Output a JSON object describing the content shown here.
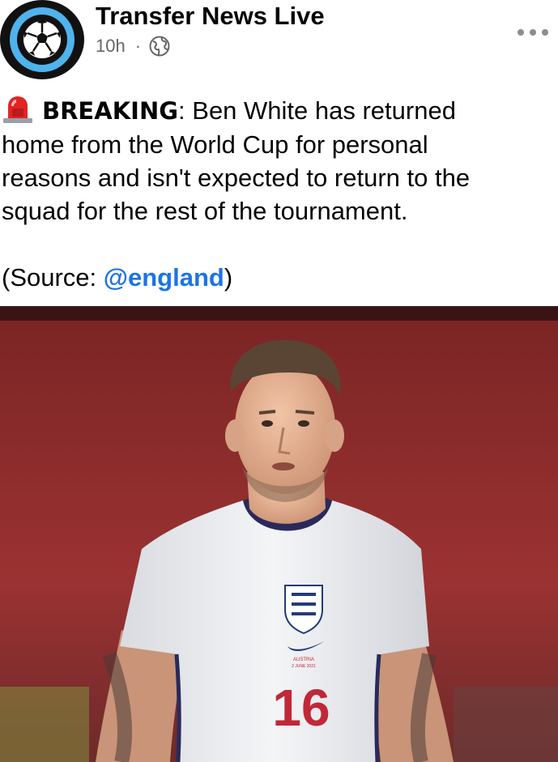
{
  "post": {
    "page_name": "Transfer News Live",
    "time": "10h",
    "separator": "·",
    "breaking_label": "BREAKING",
    "breaking_colon": ":",
    "body_line_1": " Ben White has returned",
    "body_line_2": "home from the World Cup for personal",
    "body_line_3": "reasons and isn't expected to return to the",
    "body_line_4": "squad for the rest of the tournament.",
    "source_prefix": "(Source: ",
    "source_mention": "@england",
    "source_suffix": ")"
  },
  "photo": {
    "shirt_text_line_1": "AUSTRIA",
    "shirt_text_line_2": "2 JUNE 2021",
    "shirt_number": "16"
  },
  "icons": {
    "avatar": "soccer-ball-icon",
    "audience": "globe-icon",
    "more": "more-options-icon",
    "breaking": "siren-icon"
  },
  "colors": {
    "link": "#1b74e4",
    "meta": "#65676b",
    "avatar_ring": "#4fb3ec",
    "background_red": "#8e2a2a"
  }
}
